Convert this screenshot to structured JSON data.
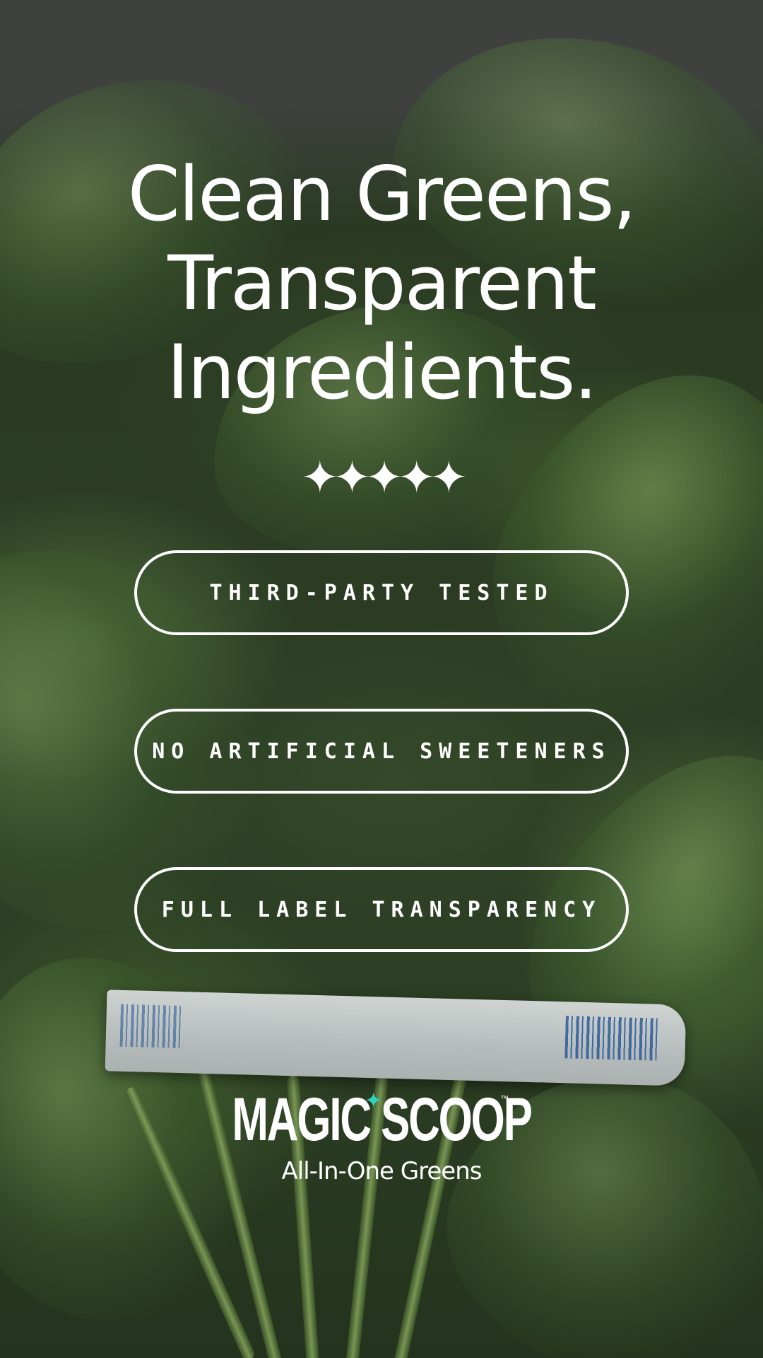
{
  "headline": {
    "line1": "Clean Greens,",
    "line2": "Transparent",
    "line3": "Ingredients."
  },
  "rating": {
    "stars": "✦✦✦✦✦",
    "value": 5,
    "max": 5
  },
  "badges": [
    {
      "label": "THIRD-PARTY TESTED"
    },
    {
      "label": "NO ARTIFICIAL SWEETENERS"
    },
    {
      "label": "FULL LABEL TRANSPARENCY"
    }
  ],
  "brand": {
    "logo_text": "MAGIC SCOOP",
    "trademark": "™",
    "tagline": "All-In-One Greens",
    "accent_color": "#2bd3c0"
  },
  "background": {
    "image": "spinach-bunch-photo"
  }
}
